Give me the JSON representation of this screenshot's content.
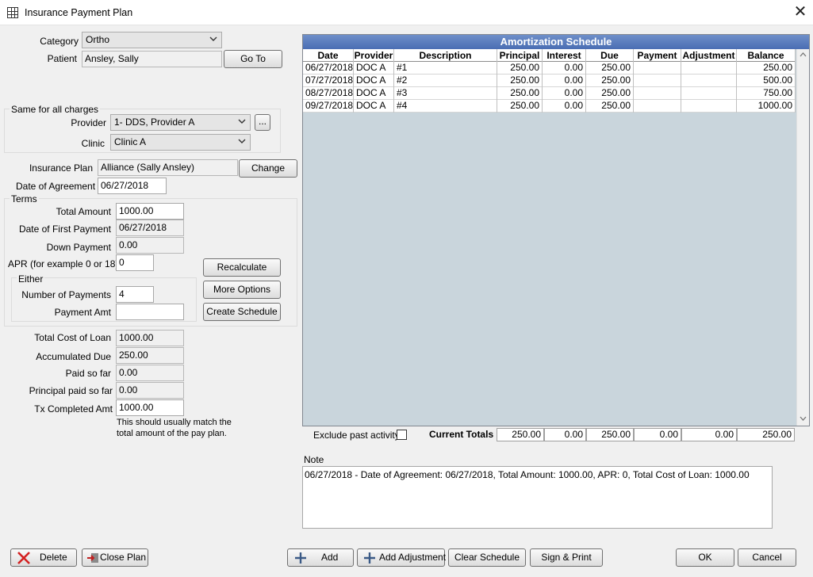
{
  "window": {
    "title": "Insurance Payment Plan",
    "icon": "grid-icon",
    "close_icon": "close-icon"
  },
  "category": {
    "label": "Category",
    "value": "Ortho"
  },
  "patient": {
    "label": "Patient",
    "value": "Ansley, Sally",
    "goto_label": "Go To"
  },
  "same_for_all": {
    "title": "Same for all charges",
    "provider_label": "Provider",
    "provider_value": "1- DDS, Provider A",
    "provider_more": "...",
    "clinic_label": "Clinic",
    "clinic_value": "Clinic A"
  },
  "insurance_plan": {
    "label": "Insurance Plan",
    "value": "Alliance (Sally Ansley)",
    "change_label": "Change"
  },
  "date_of_agreement": {
    "label": "Date of Agreement",
    "value": "06/27/2018"
  },
  "terms": {
    "title": "Terms",
    "total_amount_label": "Total Amount",
    "total_amount": "1000.00",
    "first_payment_label": "Date of First Payment",
    "first_payment": "06/27/2018",
    "down_payment_label": "Down Payment",
    "down_payment": "0.00",
    "apr_label": "APR (for example 0 or 18)",
    "apr": "0",
    "either_title": "Either",
    "num_payments_label": "Number of Payments",
    "num_payments": "4",
    "payment_amt_label": "Payment Amt",
    "payment_amt": "",
    "recalculate": "Recalculate",
    "more_options": "More Options",
    "create_schedule": "Create Schedule"
  },
  "summary": {
    "total_cost_label": "Total Cost of Loan",
    "total_cost": "1000.00",
    "accum_due_label": "Accumulated Due",
    "accum_due": "250.00",
    "paid_label": "Paid so far",
    "paid": "0.00",
    "principal_paid_label": "Principal paid so far",
    "principal_paid": "0.00",
    "tx_completed_label": "Tx Completed Amt",
    "tx_completed": "1000.00",
    "hint_line1": "This should usually match the",
    "hint_line2": "total amount of the pay plan."
  },
  "schedule": {
    "title": "Amortization Schedule",
    "columns": [
      "Date",
      "Provider",
      "Description",
      "Principal",
      "Interest",
      "Due",
      "Payment",
      "Adjustment",
      "Balance"
    ],
    "rows": [
      [
        "06/27/2018",
        "DOC A",
        "#1",
        "250.00",
        "0.00",
        "250.00",
        "",
        "",
        "250.00"
      ],
      [
        "07/27/2018",
        "DOC A",
        "#2",
        "250.00",
        "0.00",
        "250.00",
        "",
        "",
        "500.00"
      ],
      [
        "08/27/2018",
        "DOC A",
        "#3",
        "250.00",
        "0.00",
        "250.00",
        "",
        "",
        "750.00"
      ],
      [
        "09/27/2018",
        "DOC A",
        "#4",
        "250.00",
        "0.00",
        "250.00",
        "",
        "",
        "1000.00"
      ]
    ],
    "exclude_label": "Exclude past activity",
    "totals_label": "Current Totals",
    "totals": [
      "250.00",
      "0.00",
      "250.00",
      "0.00",
      "0.00",
      "250.00"
    ]
  },
  "note": {
    "label": "Note",
    "text": "06/27/2018 - Date of Agreement: 06/27/2018, Total Amount: 1000.00, APR: 0, Total Cost of Loan: 1000.00"
  },
  "footer": {
    "delete": "Delete",
    "close_plan": "Close Plan",
    "add": "Add",
    "add_adjustment": "Add Adjustment",
    "clear_schedule": "Clear Schedule",
    "sign_print": "Sign & Print",
    "ok": "OK",
    "cancel": "Cancel"
  }
}
